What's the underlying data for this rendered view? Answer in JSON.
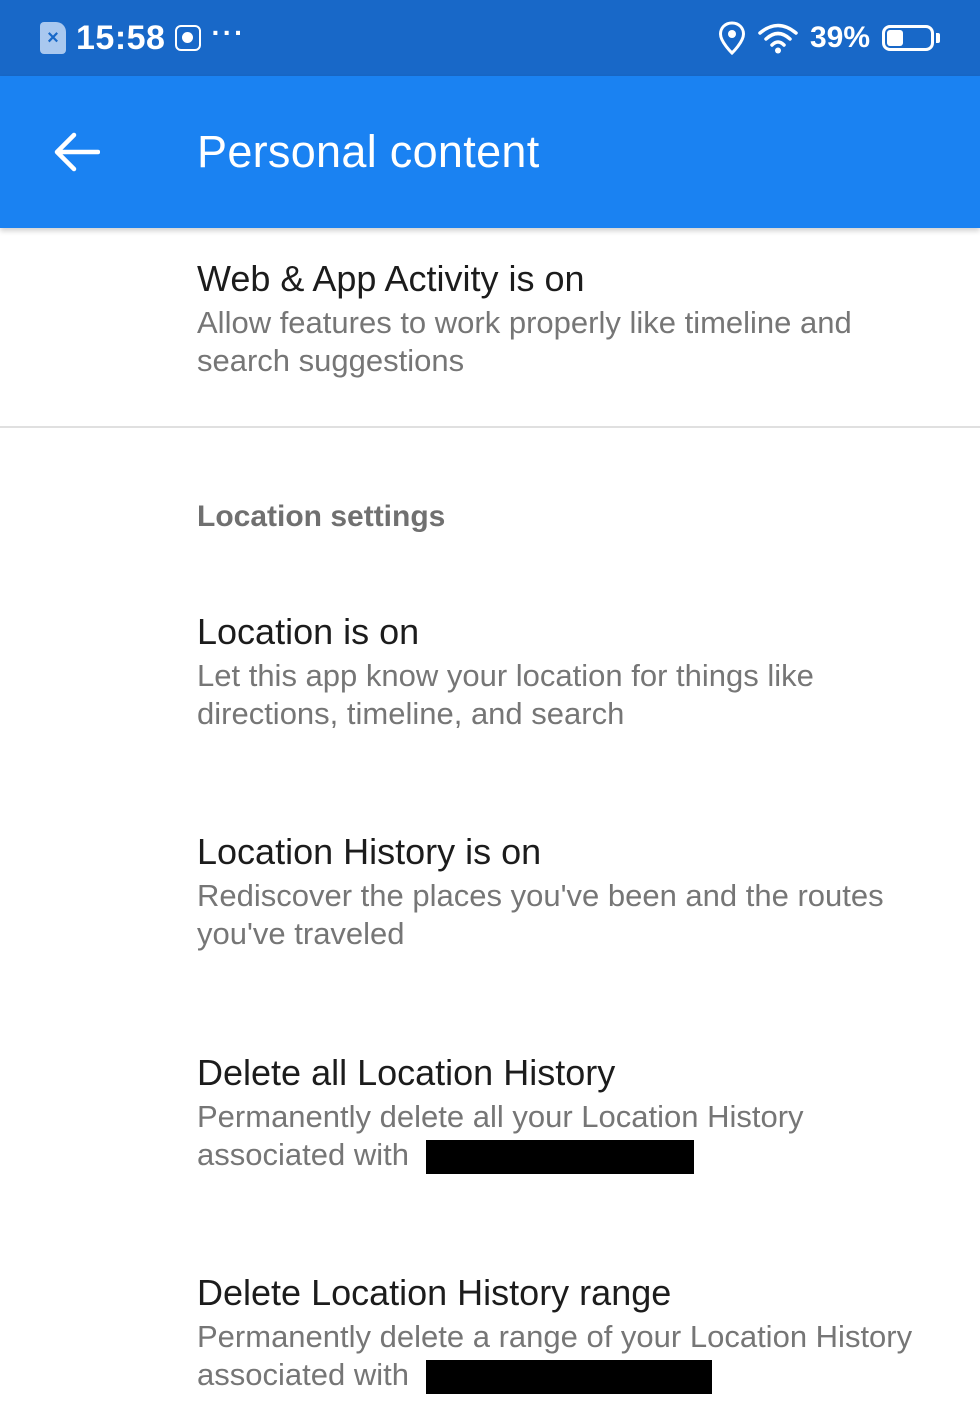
{
  "status_bar": {
    "time": "15:58",
    "battery_percent": "39%",
    "battery_level": 0.39,
    "sim_icon": "sim-card-icon",
    "notification_icon": "notification-icon",
    "more": "···",
    "location_icon": "location-pin-icon",
    "wifi_icon": "wifi-icon",
    "battery_icon": "battery-icon"
  },
  "app_bar": {
    "title": "Personal content",
    "back_icon": "back-arrow-icon",
    "color": "#1a82f2"
  },
  "items": [
    {
      "title": "Web & App Activity is on",
      "summary": "Allow features to work properly like timeline and search suggestions"
    }
  ],
  "location_section": {
    "header": "Location settings",
    "items": [
      {
        "title": "Location is on",
        "summary": "Let this app know your location for things like directions, timeline, and search"
      },
      {
        "title": "Location History is on",
        "summary": "Rediscover the places you've been and the routes you've traveled"
      },
      {
        "title": "Delete all Location History",
        "summary_prefix": "Permanently delete all your Location History associated with"
      },
      {
        "title": "Delete Location History range",
        "summary_prefix": "Permanently delete a range of your Location History associated with"
      }
    ]
  },
  "colors": {
    "status_bar": "#1868c8",
    "app_bar": "#1a82f2",
    "title_text": "#1c1c1c",
    "summary_text": "#767676"
  }
}
